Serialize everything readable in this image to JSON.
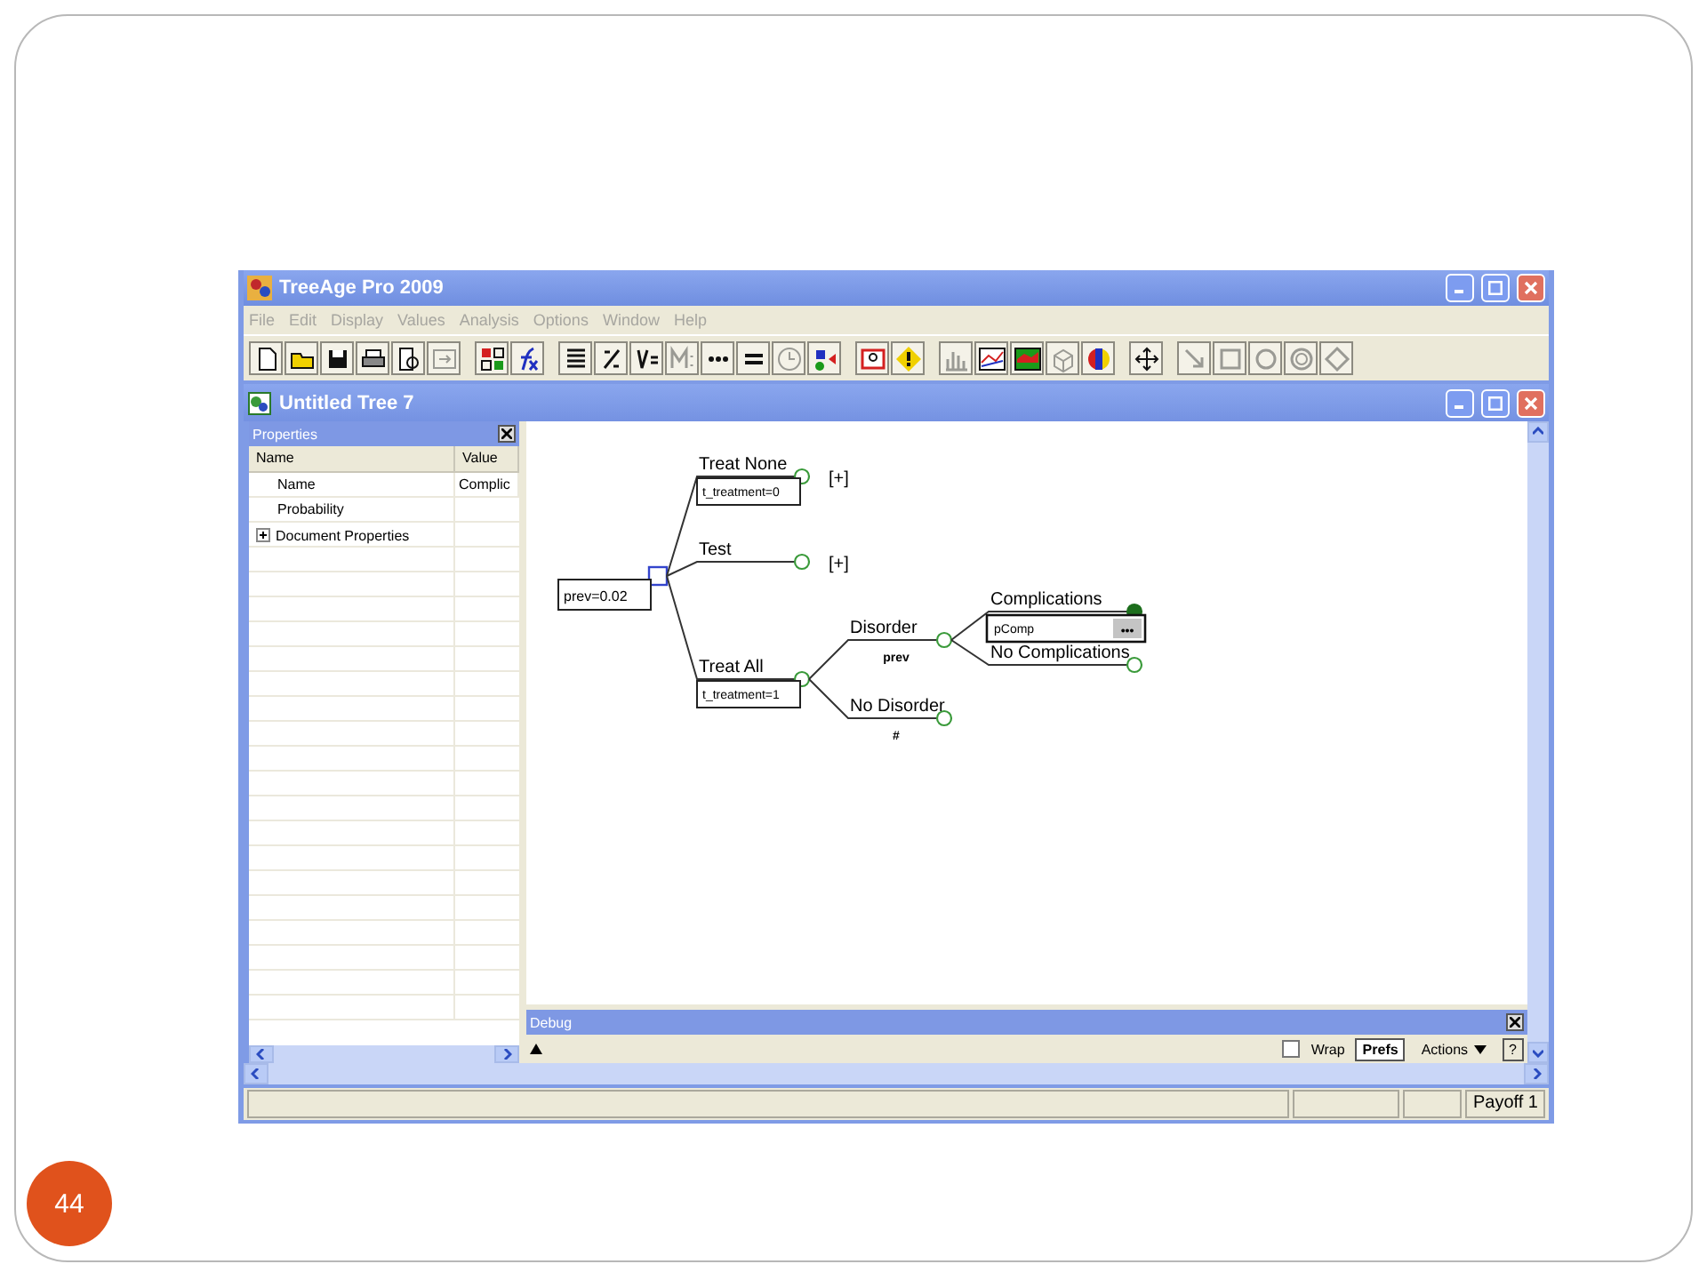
{
  "app": {
    "title": "TreeAge Pro 2009"
  },
  "menu": [
    {
      "label": "File",
      "disabled": true
    },
    {
      "label": "Edit",
      "disabled": true
    },
    {
      "label": "Display",
      "disabled": true
    },
    {
      "label": "Values",
      "disabled": true
    },
    {
      "label": "Analysis",
      "disabled": true
    },
    {
      "label": "Options",
      "disabled": true
    },
    {
      "label": "Window",
      "disabled": true
    },
    {
      "label": "Help",
      "disabled": true
    }
  ],
  "toolbar": [
    [
      {
        "kind": "new",
        "disabled": false
      },
      {
        "kind": "open",
        "disabled": false
      },
      {
        "kind": "save",
        "disabled": false
      },
      {
        "kind": "print",
        "disabled": false
      },
      {
        "kind": "preview",
        "disabled": false
      },
      {
        "kind": "export",
        "disabled": true
      }
    ],
    [
      {
        "kind": "matrix",
        "disabled": false
      },
      {
        "kind": "function",
        "disabled": false
      }
    ],
    [
      {
        "kind": "list",
        "disabled": false
      },
      {
        "kind": "fraction",
        "disabled": false
      },
      {
        "kind": "variable",
        "disabled": false
      },
      {
        "kind": "markov",
        "disabled": true
      },
      {
        "kind": "ellipsis",
        "disabled": false
      },
      {
        "kind": "equals",
        "disabled": false
      },
      {
        "kind": "clock",
        "disabled": true
      },
      {
        "kind": "nodes",
        "disabled": false
      }
    ],
    [
      {
        "kind": "help",
        "disabled": false
      },
      {
        "kind": "warning",
        "disabled": false
      }
    ],
    [
      {
        "kind": "barchart",
        "disabled": true
      },
      {
        "kind": "sens",
        "disabled": false
      },
      {
        "kind": "sens2",
        "disabled": false
      },
      {
        "kind": "cube",
        "disabled": true
      },
      {
        "kind": "colors",
        "disabled": false
      }
    ],
    [
      {
        "kind": "move",
        "disabled": false
      }
    ],
    [
      {
        "kind": "arrow",
        "disabled": true
      },
      {
        "kind": "square",
        "disabled": true
      },
      {
        "kind": "circle",
        "disabled": true
      },
      {
        "kind": "ring",
        "disabled": true
      },
      {
        "kind": "diamond",
        "disabled": true
      }
    ]
  ],
  "document": {
    "title": "Untitled Tree 7"
  },
  "properties": {
    "title": "Properties",
    "columns": [
      "Name",
      "Value"
    ],
    "rows": [
      {
        "kind": "field",
        "name": "Name",
        "value": "Complic"
      },
      {
        "kind": "field",
        "name": "Probability"
      },
      {
        "kind": "group",
        "name": "Document Properties",
        "expanded": false
      }
    ]
  },
  "tree": {
    "kind": "decision",
    "selected": false,
    "note": "prev=0.02",
    "children": [
      {
        "kind": "chance",
        "label": "Treat None",
        "selected": false,
        "note": "t_treatment=0",
        "collapsed_mark": "[+]"
      },
      {
        "kind": "chance",
        "label": "Test",
        "selected": false,
        "collapsed_mark": "[+]"
      },
      {
        "kind": "chance",
        "label": "Treat All",
        "selected": false,
        "note": "t_treatment=1",
        "children": [
          {
            "kind": "chance",
            "label": "Disorder",
            "selected": false,
            "probability": "prev",
            "children": [
              {
                "kind": "chance",
                "label": "Complications",
                "selected": true,
                "editor": {
                  "value": "pComp",
                  "button": "•••"
                }
              },
              {
                "kind": "chance",
                "label": "No Complications",
                "selected": false
              }
            ]
          },
          {
            "kind": "chance",
            "label": "No Disorder",
            "selected": false,
            "probability": "#"
          }
        ]
      }
    ]
  },
  "debug": {
    "title": "Debug",
    "wrap": {
      "label": "Wrap",
      "checked": false
    },
    "buttons": [
      {
        "kind": "toggle",
        "label": "Prefs"
      },
      {
        "kind": "menu",
        "label": "Actions"
      },
      {
        "kind": "plain",
        "label": "?"
      }
    ]
  },
  "status_bar": {
    "panels": [
      "Payoff 1"
    ]
  },
  "slide": {
    "number": "44"
  }
}
